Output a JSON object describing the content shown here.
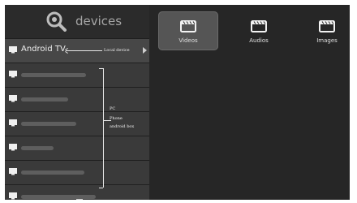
{
  "sidebar": {
    "title": "devices",
    "devices": [
      {
        "label": "Android TV",
        "active": true
      },
      {
        "label": "",
        "active": false
      },
      {
        "label": "",
        "active": false
      },
      {
        "label": "",
        "active": false
      },
      {
        "label": "",
        "active": false
      },
      {
        "label": "",
        "active": false
      },
      {
        "label": "",
        "active": false
      }
    ]
  },
  "annotations": {
    "local_device": "Local device",
    "pc": "PC",
    "phone": "Phone",
    "android_box": "android box"
  },
  "media": {
    "tiles": [
      {
        "label": "Videos",
        "icon": "clapperboard-icon",
        "selected": true
      },
      {
        "label": "Audios",
        "icon": "clapperboard-icon",
        "selected": false
      },
      {
        "label": "Images",
        "icon": "clapperboard-icon",
        "selected": false
      }
    ]
  }
}
